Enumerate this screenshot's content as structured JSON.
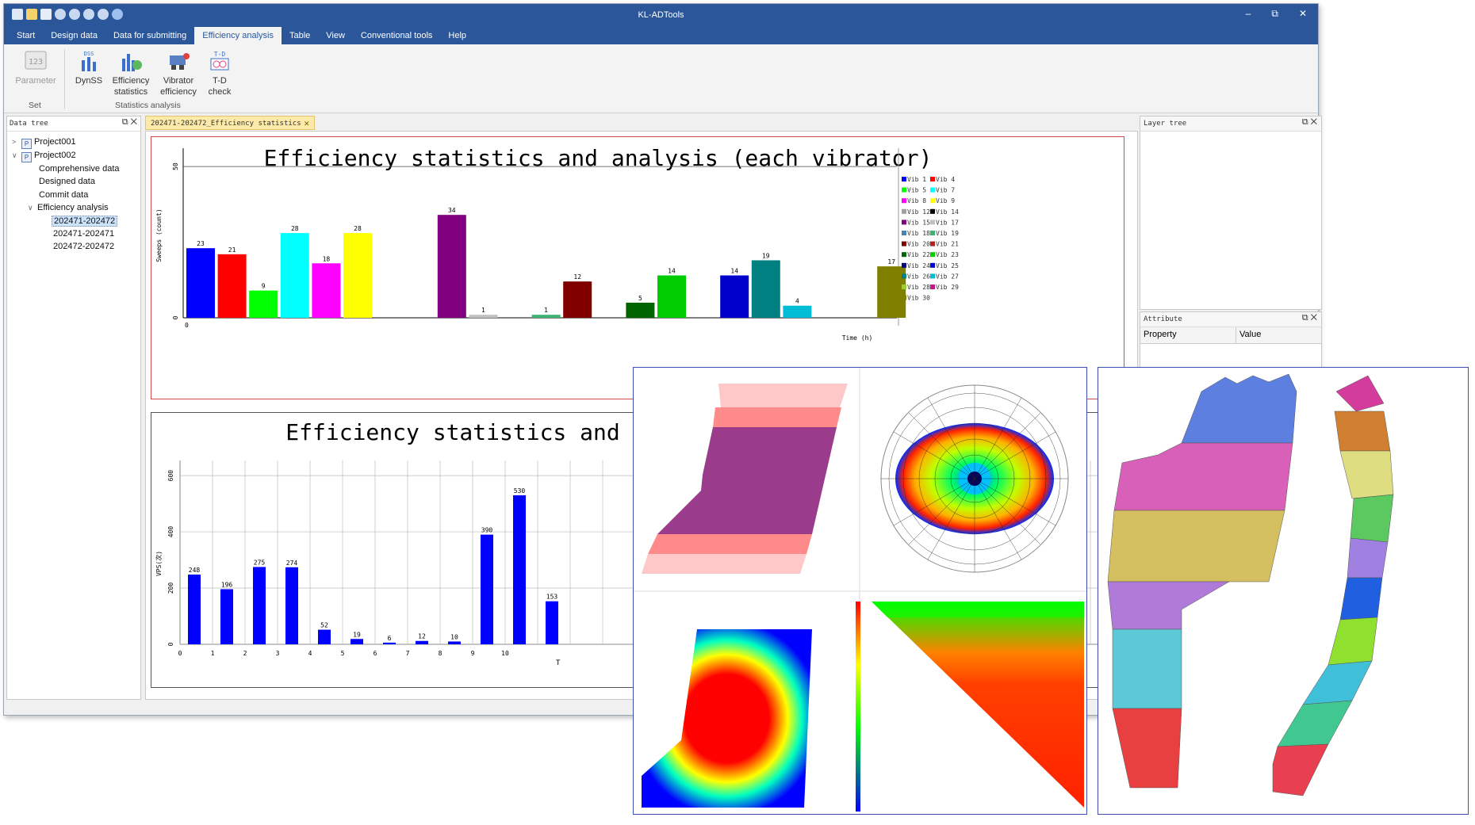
{
  "window": {
    "title": "KL-ADTools",
    "controls": [
      "–",
      "⧉",
      "✕"
    ]
  },
  "menu": [
    "Start",
    "Design data",
    "Data for submitting",
    "Efficiency analysis",
    "Table",
    "View",
    "Conventional tools",
    "Help"
  ],
  "menu_active": "Efficiency analysis",
  "ribbon": {
    "parameter": "Parameter",
    "dynss": "DynSS",
    "dss_label": "DSS",
    "efficiency_statistics": [
      "Efficiency",
      "statistics"
    ],
    "vibrator_efficiency": [
      "Vibrator",
      "efficiency"
    ],
    "td_check": [
      "T-D",
      "check"
    ],
    "td_label": "T-D",
    "group_set": "Set",
    "group_statistics": "Statistics analysis"
  },
  "data_tree": {
    "title": "Data tree",
    "items": [
      "Project001",
      "Project002",
      "Comprehensive data",
      "Designed data",
      "Commit data",
      "Efficiency analysis",
      "202471-202472",
      "202471-202471",
      "202472-202472"
    ],
    "selected": "202471-202472"
  },
  "document_tab": "202471-202472_Efficiency statistics",
  "layer_tree": {
    "title": "Layer tree"
  },
  "attribute": {
    "title": "Attribute",
    "col_property": "Property",
    "col_value": "Value"
  },
  "chart_data": [
    {
      "type": "bar",
      "title": "Efficiency statistics and analysis (each vibrator)",
      "xlabel": "Time (h)",
      "ylabel": "Sweeps (count)",
      "ylim": [
        0,
        55
      ],
      "yticks": [
        0,
        50
      ],
      "x_start_tick": "0",
      "legend_position": "right",
      "series": [
        {
          "name": "Vib 1",
          "value": 23,
          "color": "#0000ff"
        },
        {
          "name": "Vib 4",
          "value": 21,
          "color": "#ff0000"
        },
        {
          "name": "Vib 5",
          "value": 9,
          "color": "#00ff00"
        },
        {
          "name": "Vib 7",
          "value": 28,
          "color": "#00ffff"
        },
        {
          "name": "Vib 8",
          "value": 18,
          "color": "#ff00ff"
        },
        {
          "name": "Vib 9",
          "value": 28,
          "color": "#ffff00"
        },
        {
          "name": "Vib 12",
          "value": null,
          "color": "#a0a0a0"
        },
        {
          "name": "Vib 14",
          "value": null,
          "color": "#000000"
        },
        {
          "name": "Vib 15",
          "value": 34,
          "color": "#800080"
        },
        {
          "name": "Vib 17",
          "value": 1,
          "color": "#c0c0c0"
        },
        {
          "name": "Vib 18",
          "value": null,
          "color": "#4682b4"
        },
        {
          "name": "Vib 19",
          "value": 1,
          "color": "#3cb371"
        },
        {
          "name": "Vib 20",
          "value": 12,
          "color": "#800000"
        },
        {
          "name": "Vib 21",
          "value": null,
          "color": "#b22222"
        },
        {
          "name": "Vib 22",
          "value": 5,
          "color": "#006400"
        },
        {
          "name": "Vib 23",
          "value": 14,
          "color": "#00cc00"
        },
        {
          "name": "Vib 24",
          "value": null,
          "color": "#000080"
        },
        {
          "name": "Vib 25",
          "value": 14,
          "color": "#0000cd"
        },
        {
          "name": "Vib 26",
          "value": 19,
          "color": "#008080"
        },
        {
          "name": "Vib 27",
          "value": 4,
          "color": "#00bcd4"
        },
        {
          "name": "Vib 28",
          "value": null,
          "color": "#9acd32"
        },
        {
          "name": "Vib 29",
          "value": null,
          "color": "#c71585"
        },
        {
          "name": "Vib 30",
          "value": 17,
          "color": "#808000"
        }
      ]
    },
    {
      "type": "bar",
      "title": "Efficiency statistics and",
      "ylabel": "VPS(次)",
      "xlabel": "T",
      "ylim": [
        0,
        620
      ],
      "yticks": [
        0,
        200,
        400,
        600
      ],
      "categories": [
        "0",
        "1",
        "2",
        "3",
        "4",
        "5",
        "6",
        "7",
        "8",
        "9",
        "10"
      ],
      "values": [
        248,
        196,
        275,
        274,
        52,
        19,
        6,
        12,
        10,
        390,
        530,
        153
      ],
      "bar_color": "#0000ff"
    }
  ]
}
